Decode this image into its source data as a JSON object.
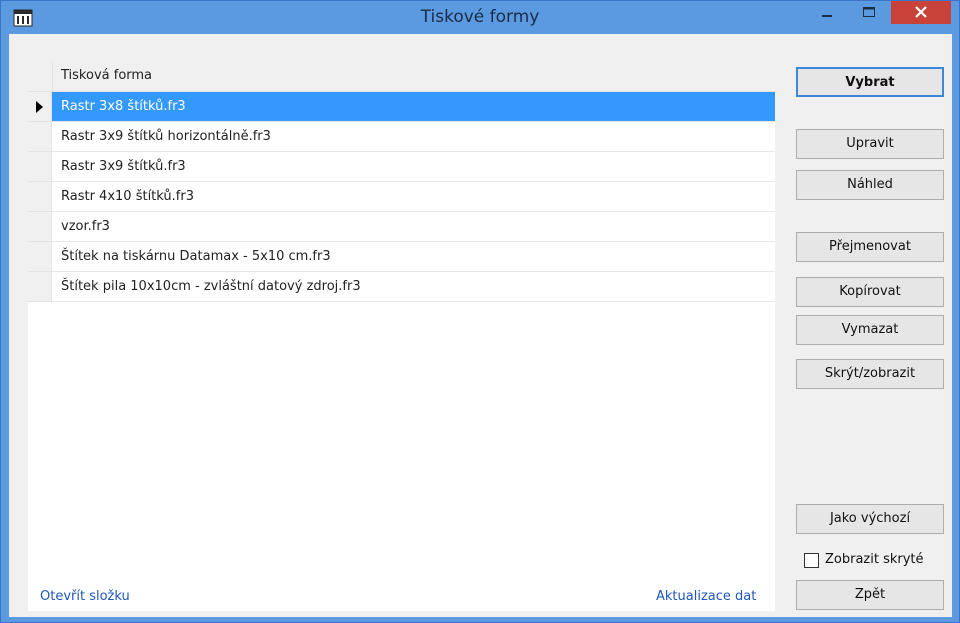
{
  "window": {
    "title": "Tiskové formy",
    "titlebar_color": "#5b9ae0",
    "close_button_color": "#c8423a"
  },
  "grid": {
    "column_header": "Tisková forma",
    "selected_index": 0,
    "rows": [
      "Rastr 3x8 štítků.fr3",
      "Rastr 3x9 štítků horizontálně.fr3",
      "Rastr 3x9 štítků.fr3",
      "Rastr 4x10 štítků.fr3",
      "vzor.fr3",
      "Štítek na tiskárnu Datamax - 5x10 cm.fr3",
      "Štítek pila 10x10cm - zvláštní datový zdroj.fr3"
    ],
    "selection_color": "#3399ff"
  },
  "footer": {
    "open_folder": "Otevřít složku",
    "refresh_data": "Aktualizace dat"
  },
  "buttons": {
    "select": "Vybrat",
    "edit": "Upravit",
    "preview": "Náhled",
    "rename": "Přejmenovat",
    "copy": "Kopírovat",
    "delete": "Vymazat",
    "hide_show": "Skrýt/zobrazit",
    "set_default": "Jako výchozí",
    "back": "Zpět"
  },
  "show_hidden": {
    "label": "Zobrazit skryté",
    "checked": false
  },
  "icons": {
    "app": "app-window-icon",
    "minimize": "minimize-icon",
    "maximize": "maximize-icon",
    "close": "close-icon",
    "row_pointer": "row-pointer-icon"
  }
}
